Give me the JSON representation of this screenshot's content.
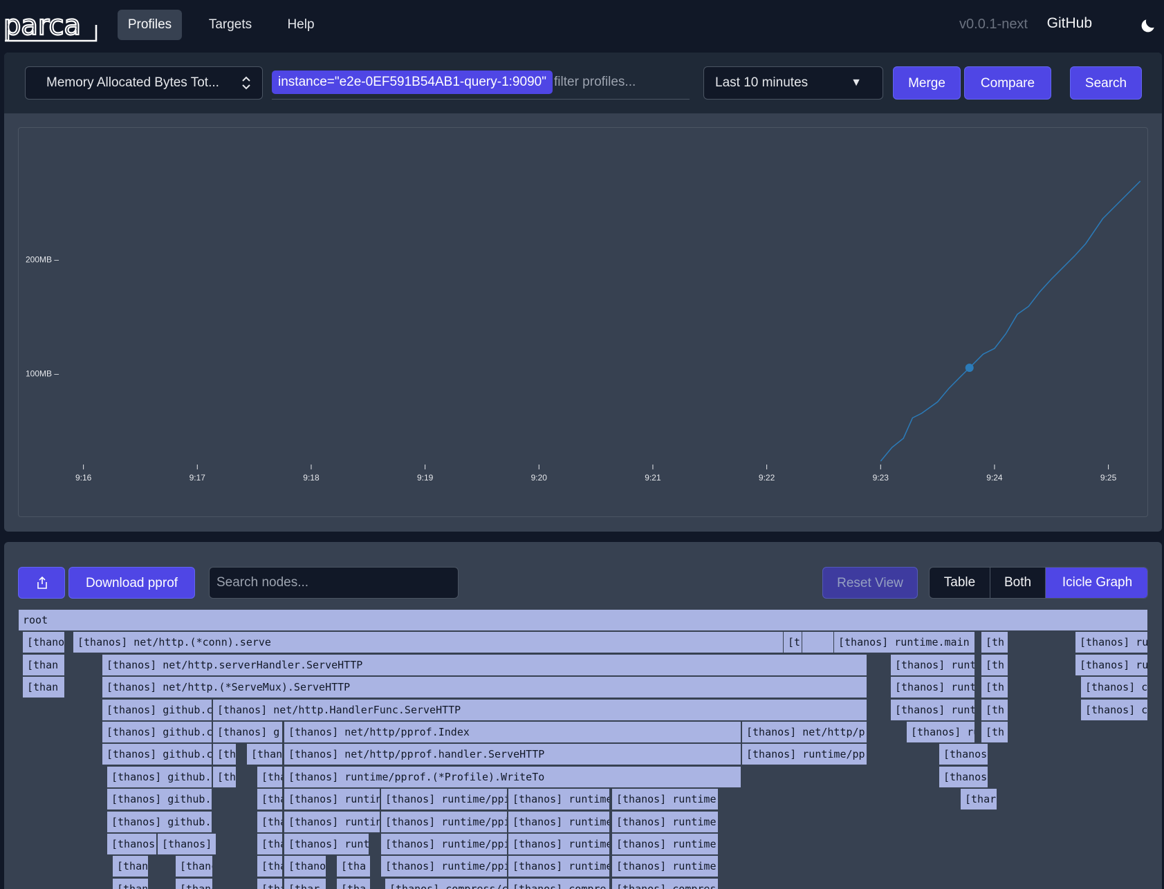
{
  "nav": {
    "logo_text": "parca",
    "links": [
      "Profiles",
      "Targets",
      "Help"
    ],
    "version": "v0.0.1-next",
    "github": "GitHub",
    "theme_icon": "moon-icon"
  },
  "query": {
    "profile_type": "Memory Allocated Bytes Tot...",
    "matcher": "instance=\"e2e-0EF591B54AB1-query-1:9090\"",
    "filter_placeholder": "filter profiles...",
    "time_range": "Last 10 minutes",
    "time_arrow": "▼",
    "merge_label": "Merge",
    "compare_label": "Compare",
    "search_label": "Search"
  },
  "chart_data": {
    "type": "line",
    "title": "",
    "xlabel": "",
    "ylabel": "",
    "y_unit": "MB",
    "x_ticks": [
      "9:16",
      "9:17",
      "9:18",
      "9:19",
      "9:20",
      "9:21",
      "9:22",
      "9:23",
      "9:24",
      "9:25"
    ],
    "y_ticks": [
      {
        "value": 100,
        "label": "100MB"
      },
      {
        "value": 200,
        "label": "200MB"
      }
    ],
    "x_range_minutes": [
      15.65,
      25.3
    ],
    "y_range": [
      20,
      300
    ],
    "series": [
      {
        "color": "#2b7bb9",
        "x_minutes": [
          23.0,
          23.1,
          23.2,
          23.28,
          23.36,
          23.5,
          23.6,
          23.7,
          23.8,
          23.9,
          24.0,
          24.1,
          24.2,
          24.3,
          24.4,
          24.5,
          24.6,
          24.7,
          24.8,
          24.95,
          25.05,
          25.15,
          25.28
        ],
        "y_mb": [
          23,
          35,
          43,
          61,
          65,
          75,
          87,
          97,
          107,
          117,
          122,
          135,
          152,
          159,
          172,
          183,
          193,
          203,
          214,
          236,
          246,
          256,
          269
        ]
      }
    ],
    "highlight_point": {
      "x_minutes": 23.78,
      "y_mb": 105
    }
  },
  "profile_toolbar": {
    "share_icon": "share-icon",
    "download_label": "Download pprof",
    "search_placeholder": "Search nodes...",
    "reset_label": "Reset View",
    "views": [
      "Table",
      "Both",
      "Icicle Graph"
    ],
    "active_view": "Icicle Graph"
  },
  "icicle": {
    "node_color": "#aab4e3",
    "rows": [
      [
        [
          "root"
        ]
      ],
      [
        [
          "[thanos] net/http.(*conn).serve"
        ],
        [
          "[thanos] runtime.main"
        ],
        [
          "[thanos] runtime"
        ],
        [
          "[thano"
        ],
        [
          "[th"
        ],
        [
          "[t"
        ]
      ],
      [
        [
          "[thanos] net/http.serverHandler.ServeHTTP"
        ],
        [
          "[thanos] runtime"
        ],
        [
          "[thanos] runtime"
        ],
        [
          "[than"
        ],
        [
          "[th"
        ]
      ],
      [
        [
          "[thanos] net/http.(*ServeMux).ServeHTTP"
        ],
        [
          "[thanos] runtime"
        ],
        [
          "[thanos] com"
        ],
        [
          "[than"
        ],
        [
          "[th"
        ]
      ],
      [
        [
          "[thanos] github.c"
        ],
        [
          "[thanos] net/http.HandlerFunc.ServeHTTP"
        ],
        [
          "[thanos] runtime"
        ],
        [
          "[thanos] com"
        ],
        [
          "[th"
        ]
      ],
      [
        [
          "[thanos] github.c"
        ],
        [
          "[thanos] g"
        ],
        [
          "[thanos] net/http/pprof.Index"
        ],
        [
          "[thanos] net/http/p"
        ],
        [
          "[thanos] runt"
        ],
        [
          "[th"
        ]
      ],
      [
        [
          "[thanos] github.c"
        ],
        [
          "[th"
        ],
        [
          "[thano"
        ],
        [
          "[thanos] net/http/pprof.handler.ServeHTTP"
        ],
        [
          "[thanos] runtime/pp"
        ],
        [
          "[thanos]"
        ]
      ],
      [
        [
          "[thanos] github."
        ],
        [
          "[th"
        ],
        [
          "[tha"
        ],
        [
          "[thanos] runtime/pprof.(*Profile).WriteTo"
        ],
        [
          "[thanos]"
        ]
      ],
      [
        [
          "[thanos] github."
        ],
        [
          "[tha"
        ],
        [
          "[thanos] runtin"
        ],
        [
          "[thanos] runtime/ppi"
        ],
        [
          "[thanos] runtime"
        ],
        [
          "[thanos] runtime"
        ],
        [
          "[thar"
        ]
      ],
      [
        [
          "[thanos] github."
        ],
        [
          "[tha"
        ],
        [
          "[thanos] runtin"
        ],
        [
          "[thanos] runtime/ppi"
        ],
        [
          "[thanos] runtime"
        ],
        [
          "[thanos] runtime"
        ]
      ],
      [
        [
          "[thanos"
        ],
        [
          "[thanos]"
        ],
        [
          "[tha"
        ],
        [
          "[thanos] runt"
        ],
        [
          "[thanos] runtime/ppi"
        ],
        [
          "[thanos] runtime"
        ],
        [
          "[thanos] runtime"
        ]
      ],
      [
        [
          "[thanc"
        ],
        [
          "[thanc"
        ],
        [
          "[tha"
        ],
        [
          "[thano"
        ],
        [
          "[tha"
        ],
        [
          "[thanos] runtime/ppi"
        ],
        [
          "[thanos] runtime"
        ],
        [
          "[thanos] runtime"
        ]
      ],
      [
        [
          "[thanc"
        ],
        [
          "[thanc"
        ],
        [
          "[tha"
        ],
        [
          "[thar"
        ],
        [
          "[tha"
        ],
        [
          "[thanos] compress/c"
        ],
        [
          "[thanos] compre"
        ],
        [
          "[thanos] compres"
        ]
      ]
    ]
  }
}
